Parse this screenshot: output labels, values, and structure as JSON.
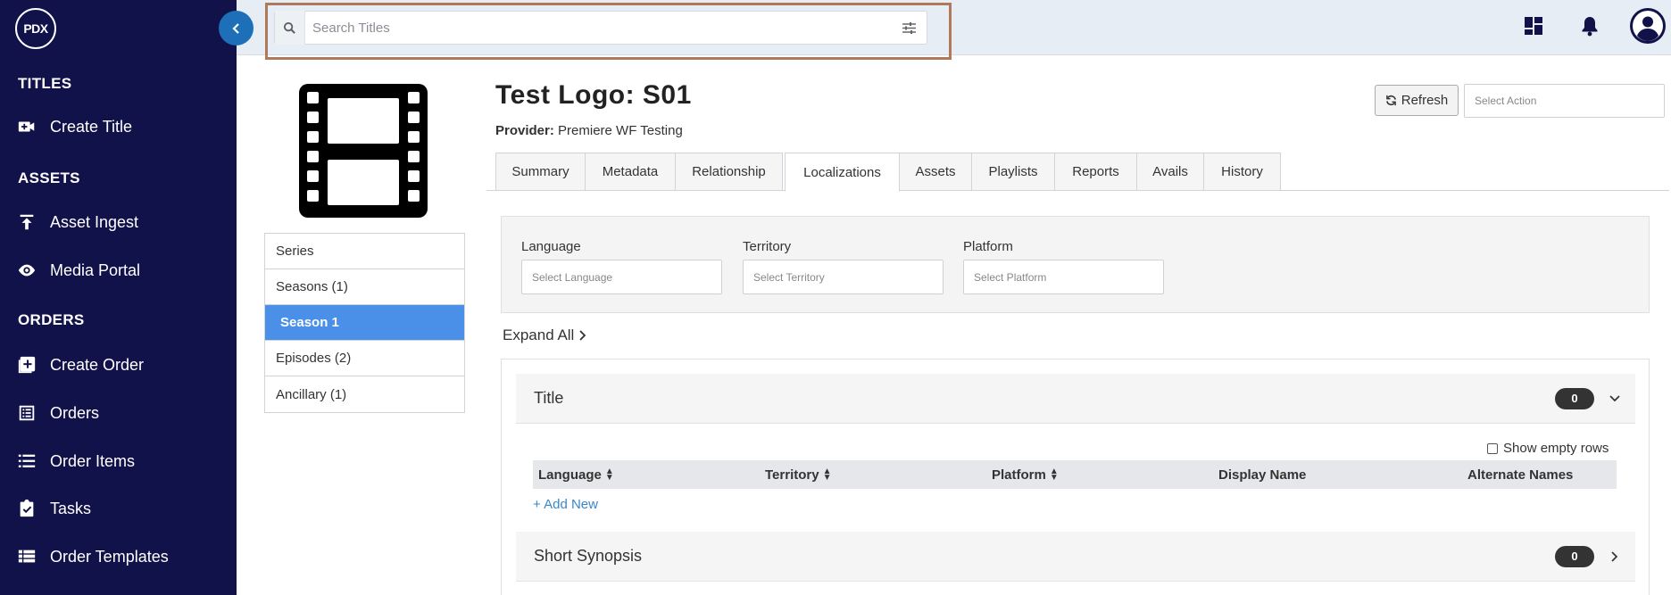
{
  "sidebar": {
    "logo": "PDX",
    "sections": [
      {
        "heading": "TITLES",
        "items": [
          {
            "label": "Create Title",
            "icon": "video-plus-icon"
          }
        ]
      },
      {
        "heading": "ASSETS",
        "items": [
          {
            "label": "Asset Ingest",
            "icon": "upload-icon"
          },
          {
            "label": "Media Portal",
            "icon": "eye-icon"
          }
        ]
      },
      {
        "heading": "ORDERS",
        "items": [
          {
            "label": "Create Order",
            "icon": "add-box-icon"
          },
          {
            "label": "Orders",
            "icon": "list-box-icon"
          },
          {
            "label": "Order Items",
            "icon": "list-icon"
          },
          {
            "label": "Tasks",
            "icon": "clipboard-check-icon"
          },
          {
            "label": "Order Templates",
            "icon": "table-icon"
          }
        ]
      }
    ]
  },
  "topbar": {
    "search_placeholder": "Search Titles",
    "icons": [
      "dashboard-icon",
      "bell-icon",
      "user-avatar-icon"
    ]
  },
  "title_page": {
    "title": "Test Logo: S01",
    "provider_label": "Provider:",
    "provider_value": "Premiere WF Testing",
    "refresh_label": "Refresh",
    "select_action_placeholder": "Select Action"
  },
  "tree": {
    "items": [
      "Series",
      "Seasons (1)",
      "Season 1",
      "Episodes (2)",
      "Ancillary (1)"
    ],
    "active_index": 2
  },
  "tabs": {
    "items": [
      "Summary",
      "Metadata",
      "Relationship",
      "Localizations",
      "Assets",
      "Playlists",
      "Reports",
      "Avails",
      "History"
    ],
    "active": "Localizations"
  },
  "filters": {
    "language_label": "Language",
    "language_placeholder": "Select Language",
    "territory_label": "Territory",
    "territory_placeholder": "Select Territory",
    "platform_label": "Platform",
    "platform_placeholder": "Select Platform"
  },
  "localizations": {
    "expand_all": "Expand All",
    "show_empty_rows": "Show empty rows",
    "sections": [
      {
        "name": "Title",
        "count": "0",
        "expanded": true
      },
      {
        "name": "Short Synopsis",
        "count": "0",
        "expanded": false
      }
    ],
    "columns": [
      "Language",
      "Territory",
      "Platform",
      "Display Name",
      "Alternate Names"
    ],
    "add_new": "+ Add New"
  },
  "colors": {
    "sidebar_bg": "#12124a",
    "active_tree": "#4a90e8",
    "topbar_bg": "#e6edf5",
    "search_highlight": "#b07a5a",
    "link": "#3b86c9"
  }
}
